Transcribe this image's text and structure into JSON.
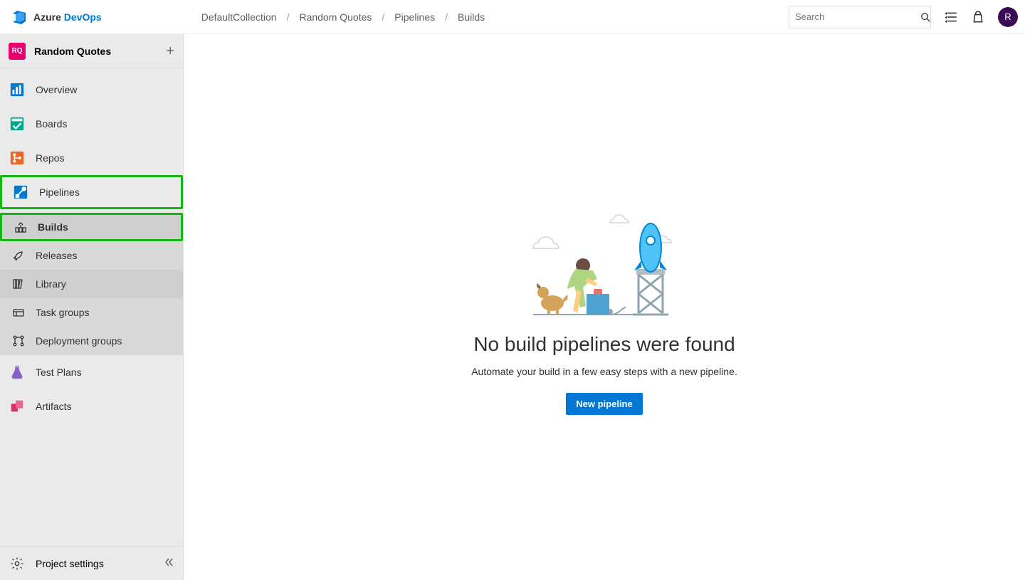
{
  "header": {
    "logo_text_a": "Azure ",
    "logo_text_b": "DevOps",
    "breadcrumb": [
      "DefaultCollection",
      "Random Quotes",
      "Pipelines",
      "Builds"
    ],
    "search_placeholder": "Search",
    "avatar_letter": "R"
  },
  "project": {
    "badge": "RQ",
    "name": "Random Quotes"
  },
  "sidebar": {
    "items": [
      {
        "label": "Overview"
      },
      {
        "label": "Boards"
      },
      {
        "label": "Repos"
      },
      {
        "label": "Pipelines"
      }
    ],
    "pipelines_sub": [
      {
        "label": "Builds"
      },
      {
        "label": "Releases"
      },
      {
        "label": "Library"
      },
      {
        "label": "Task groups"
      },
      {
        "label": "Deployment groups"
      }
    ],
    "after_pipelines": [
      {
        "label": "Test Plans"
      },
      {
        "label": "Artifacts"
      }
    ],
    "footer_label": "Project settings"
  },
  "empty_state": {
    "title": "No build pipelines were found",
    "subtitle": "Automate your build in a few easy steps with a new pipeline.",
    "button": "New pipeline"
  },
  "colors": {
    "accent": "#0078d4",
    "brand_pink": "#e6006e",
    "highlight_green": "#13b713",
    "avatar_bg": "#3b0a54"
  }
}
